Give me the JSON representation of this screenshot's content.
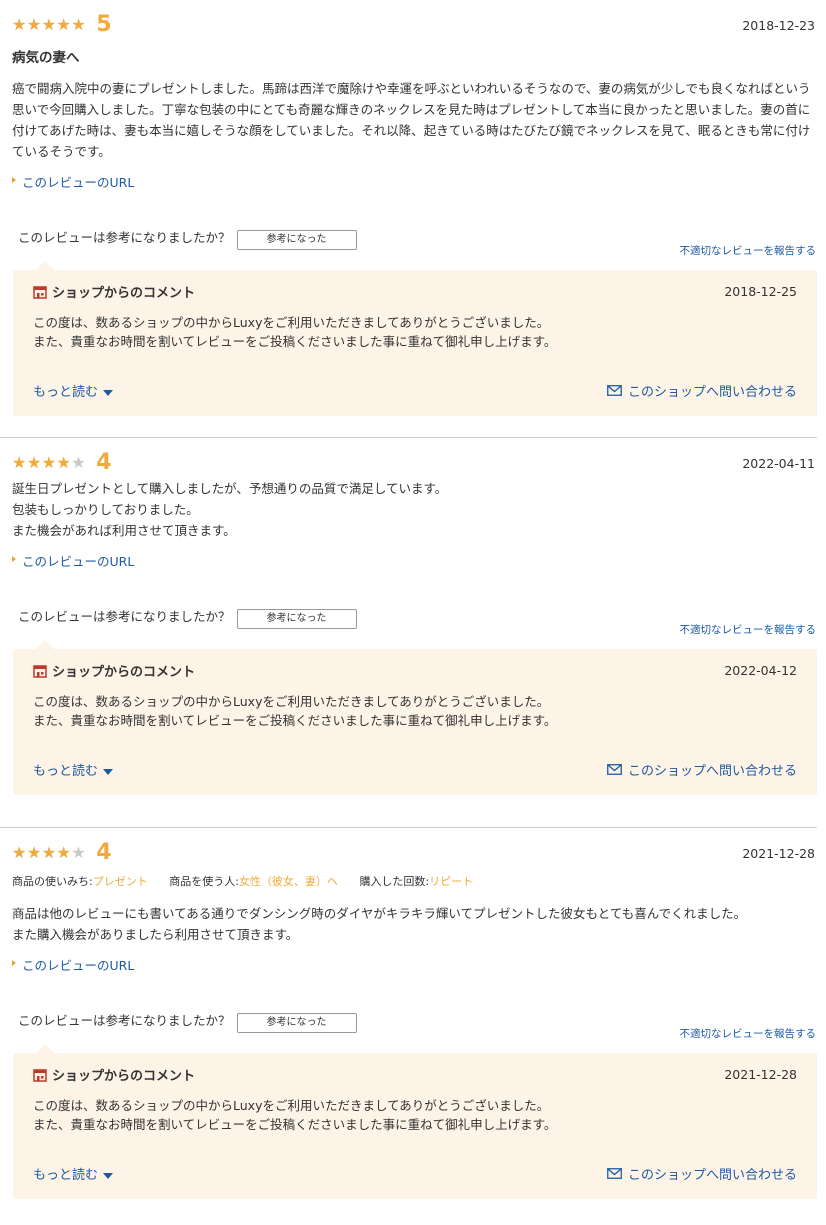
{
  "reviews": [
    {
      "stars": "★★★★★",
      "score": "5",
      "date": "2018-12-23",
      "title": "病気の妻へ",
      "body": "癌で闘病入院中の妻にプレゼントしました。馬蹄は西洋で魔除けや幸運を呼ぶといわれいるそうなので、妻の病気が少しでも良くなればという思いで今回購入しました。丁寧な包装の中にとても奇麗な輝きのネックレスを見た時はプレゼントして本当に良かったと思いました。妻の首に付けてあげた時は、妻も本当に嬉しそうな顔をしていました。それ以降、起きている時はたびたび鏡でネックレスを見て、眠るときも常に付けているそうです。",
      "url_label": "このレビューのURL",
      "helpful_question": "このレビューは参考になりましたか？",
      "helpful_button": "参考になった",
      "report_label": "不適切なレビューを報告する",
      "comment": {
        "heading": "ショップからのコメント",
        "date": "2018-12-25",
        "text": "この度は、数あるショップの中からLuxyをご利用いただきましてありがとうございました。\nまた、貴重なお時間を割いてレビューをご投稿くださいました事に重ねて御礼申し上げます。",
        "more_label": "もっと読む",
        "contact_label": "このショップへ問い合わせる"
      }
    },
    {
      "stars": "★★★★★",
      "score": "4",
      "date": "2022-04-11",
      "body": "誕生日プレゼントとして購入しましたが、予想通りの品質で満足しています。\n包装もしっかりしておりました。\nまた機会があれば利用させて頂きます。",
      "url_label": "このレビューのURL",
      "helpful_question": "このレビューは参考になりましたか？",
      "helpful_button": "参考になった",
      "report_label": "不適切なレビューを報告する",
      "comment": {
        "heading": "ショップからのコメント",
        "date": "2022-04-12",
        "text": "この度は、数あるショップの中からLuxyをご利用いただきましてありがとうございました。\nまた、貴重なお時間を割いてレビューをご投稿くださいました事に重ねて御礼申し上げます。",
        "more_label": "もっと読む",
        "contact_label": "このショップへ問い合わせる"
      }
    },
    {
      "stars": "★★★★★",
      "score": "4",
      "date": "2021-12-28",
      "meta": {
        "usage_key": "商品の使いみち:",
        "usage_val": "プレゼント",
        "user_key": "商品を使う人:",
        "user_val": "女性（彼女、妻）へ",
        "count_key": "購入した回数:",
        "count_val": "リピート"
      },
      "body": "商品は他のレビューにも書いてある通りでダンシング時のダイヤがキラキラ輝いてプレゼントした彼女もとても喜んでくれました。\nまた購入機会がありましたら利用させて頂きます。",
      "url_label": "このレビューのURL",
      "helpful_question": "このレビューは参考になりましたか？",
      "helpful_button": "参考になった",
      "report_label": "不適切なレビューを報告する",
      "comment": {
        "heading": "ショップからのコメント",
        "date": "2021-12-28",
        "text": "この度は、数あるショップの中からLuxyをご利用いただきましてありがとうございました。\nまた、貴重なお時間を割いてレビューをご投稿くださいました事に重ねて御礼申し上げます。",
        "more_label": "もっと読む",
        "contact_label": "このショップへ問い合わせる"
      }
    }
  ],
  "colors": {
    "star": "#f0ab3c",
    "link": "#1d5aa3",
    "comment_bg": "#fdf3e7"
  }
}
